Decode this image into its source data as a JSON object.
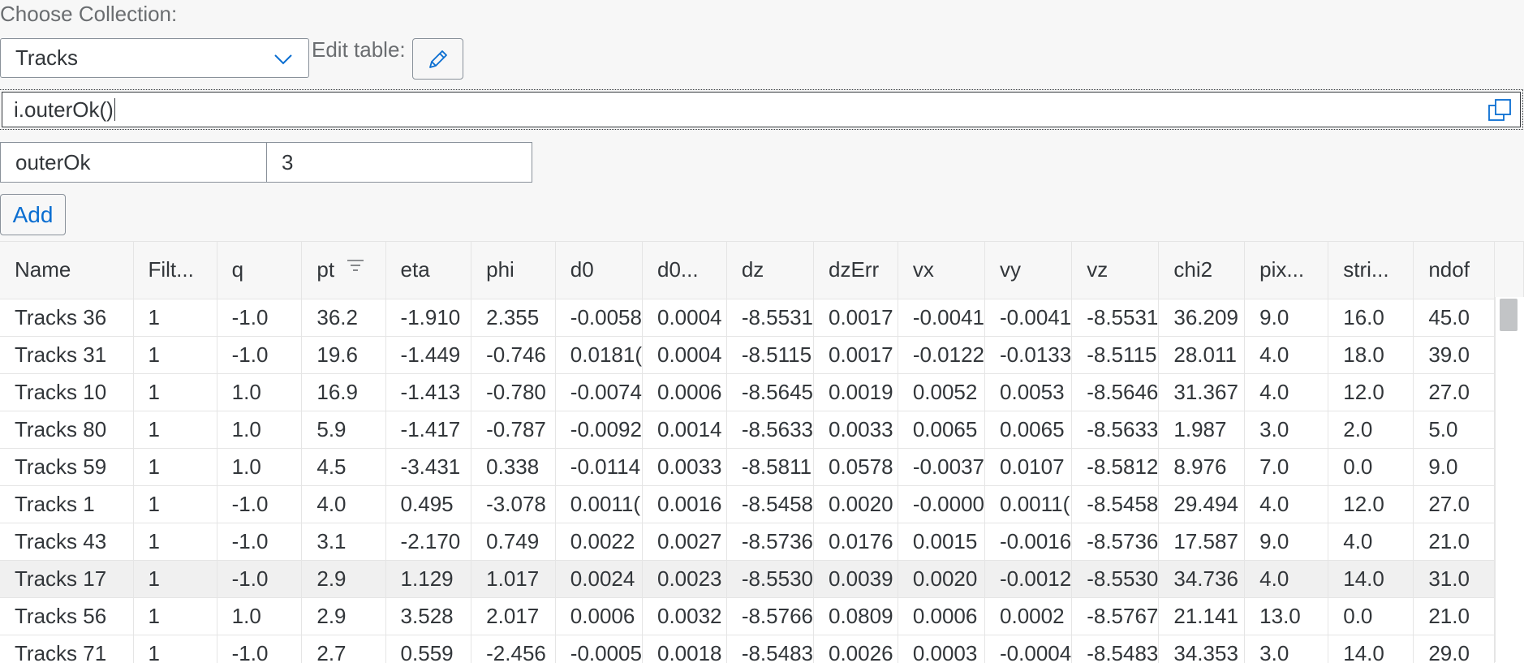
{
  "collection": {
    "label": "Choose Collection:",
    "selected": "Tracks"
  },
  "edit_table_label": "Edit table:",
  "expression": "i.outerOk()",
  "new_column": {
    "name": "outerOk",
    "value": "3"
  },
  "add_label": "Add",
  "table": {
    "columns": [
      "Name",
      "Filt...",
      "q",
      "pt",
      "eta",
      "phi",
      "d0",
      "d0...",
      "dz",
      "dzErr",
      "vx",
      "vy",
      "vz",
      "chi2",
      "pix...",
      "stri...",
      "ndof"
    ],
    "sorted_column": "pt",
    "selected_row": 7,
    "rows": [
      [
        "Tracks 36",
        "1",
        "-1.0",
        "36.2",
        "-1.910",
        "2.355",
        "-0.0058",
        "0.0004",
        "-8.5531",
        "0.0017",
        "-0.0041",
        "-0.0041",
        "-8.5531",
        "36.209",
        "9.0",
        "16.0",
        "45.0"
      ],
      [
        "Tracks 31",
        "1",
        "-1.0",
        "19.6",
        "-1.449",
        "-0.746",
        "0.0181(",
        "0.0004",
        "-8.5115",
        "0.0017",
        "-0.0122",
        "-0.0133",
        "-8.5115",
        "28.011",
        "4.0",
        "18.0",
        "39.0"
      ],
      [
        "Tracks 10",
        "1",
        "1.0",
        "16.9",
        "-1.413",
        "-0.780",
        "-0.0074",
        "0.0006",
        "-8.5645",
        "0.0019",
        "0.0052",
        "0.0053",
        "-8.5646",
        "31.367",
        "4.0",
        "12.0",
        "27.0"
      ],
      [
        "Tracks 80",
        "1",
        "1.0",
        "5.9",
        "-1.417",
        "-0.787",
        "-0.0092",
        "0.0014",
        "-8.5633",
        "0.0033",
        "0.0065",
        "0.0065",
        "-8.5633",
        "1.987",
        "3.0",
        "2.0",
        "5.0"
      ],
      [
        "Tracks 59",
        "1",
        "1.0",
        "4.5",
        "-3.431",
        "0.338",
        "-0.0114",
        "0.0033",
        "-8.5811",
        "0.0578",
        "-0.0037",
        "0.0107",
        "-8.5812",
        "8.976",
        "7.0",
        "0.0",
        "9.0"
      ],
      [
        "Tracks 1",
        "1",
        "-1.0",
        "4.0",
        "0.495",
        "-3.078",
        "0.0011(",
        "0.0016",
        "-8.5458",
        "0.0020",
        "-0.0000",
        "0.0011(",
        "-8.5458",
        "29.494",
        "4.0",
        "12.0",
        "27.0"
      ],
      [
        "Tracks 43",
        "1",
        "-1.0",
        "3.1",
        "-2.170",
        "0.749",
        "0.0022",
        "0.0027",
        "-8.5736",
        "0.0176",
        "0.0015",
        "-0.0016",
        "-8.5736",
        "17.587",
        "9.0",
        "4.0",
        "21.0"
      ],
      [
        "Tracks 17",
        "1",
        "-1.0",
        "2.9",
        "1.129",
        "1.017",
        "0.0024",
        "0.0023",
        "-8.5530",
        "0.0039",
        "0.0020",
        "-0.0012",
        "-8.5530",
        "34.736",
        "4.0",
        "14.0",
        "31.0"
      ],
      [
        "Tracks 56",
        "1",
        "1.0",
        "2.9",
        "3.528",
        "2.017",
        "0.0006",
        "0.0032",
        "-8.5766",
        "0.0809",
        "0.0006",
        "0.0002",
        "-8.5767",
        "21.141",
        "13.0",
        "0.0",
        "21.0"
      ],
      [
        "Tracks 71",
        "1",
        "-1.0",
        "2.7",
        "0.559",
        "-2.456",
        "-0.0005",
        "0.0018",
        "-8.5483",
        "0.0026",
        "0.0003",
        "-0.0004",
        "-8.5483",
        "34.353",
        "3.0",
        "14.0",
        "29.0"
      ]
    ]
  },
  "icons": {
    "dropdown": "chevron-down-icon",
    "edit": "pencil-icon",
    "copy": "copy-icon",
    "sort": "sort-descending-icon"
  },
  "colors": {
    "accent": "#0a6ed1",
    "border": "#89919a",
    "background": "#f7f7f7"
  }
}
